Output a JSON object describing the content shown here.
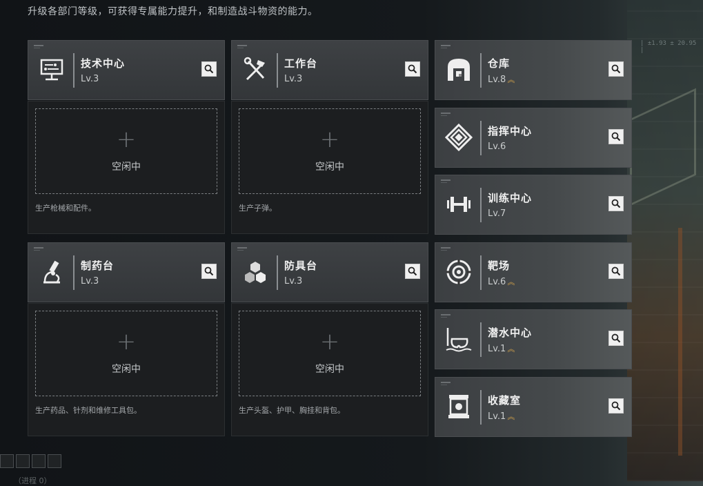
{
  "subtitle": "升级各部门等级，可获得专属能力提升，和制造战斗物资的能力。",
  "coord_text": "| ±1.93 ± 20.95 |",
  "colors": {
    "accent_up": "#d8a64a",
    "card_bg": "#3e4144",
    "slot_bg": "#1c1e20"
  },
  "left_cards": [
    {
      "name": "技术中心",
      "level": "Lv.3",
      "icon": "monitor-icon"
    },
    {
      "name": "工作台",
      "level": "Lv.3",
      "icon": "tools-icon"
    },
    {
      "name": "制药台",
      "level": "Lv.3",
      "icon": "microscope-icon"
    },
    {
      "name": "防具台",
      "level": "Lv.3",
      "icon": "blocks-icon"
    }
  ],
  "slots": [
    {
      "plus": "+",
      "status": "空闲中",
      "desc": "生产枪械和配件。"
    },
    {
      "plus": "+",
      "status": "空闲中",
      "desc": "生产子弹。"
    },
    {
      "plus": "+",
      "status": "空闲中",
      "desc": "生产药品、针剂和维修工具包。"
    },
    {
      "plus": "+",
      "status": "空闲中",
      "desc": "生产头盔、护甲、胸挂和背包。"
    }
  ],
  "right_cards": [
    {
      "name": "仓库",
      "level": "Lv.8",
      "upgrade": "︽",
      "icon": "warehouse-icon"
    },
    {
      "name": "指挥中心",
      "level": "Lv.6",
      "upgrade": "",
      "icon": "command-icon"
    },
    {
      "name": "训练中心",
      "level": "Lv.7",
      "upgrade": "",
      "icon": "dumbbell-icon"
    },
    {
      "name": "靶场",
      "level": "Lv.6",
      "upgrade": "︽",
      "icon": "target-icon"
    },
    {
      "name": "潜水中心",
      "level": "Lv.1",
      "upgrade": "︽",
      "icon": "diving-mask-icon"
    },
    {
      "name": "收藏室",
      "level": "Lv.1",
      "upgrade": "︽",
      "icon": "display-case-icon"
    }
  ],
  "bottom_text": "（进程 0）"
}
